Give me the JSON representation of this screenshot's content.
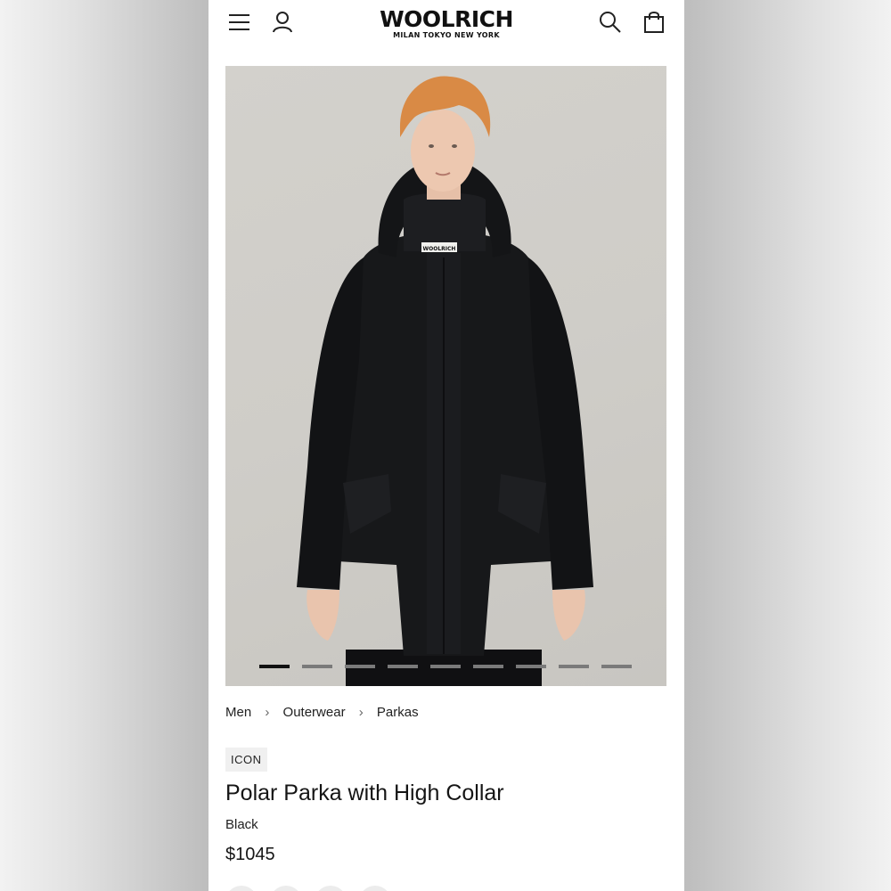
{
  "header": {
    "brand": "WOOLRICH",
    "tagline": "MILAN TOKYO NEW YORK",
    "icons": [
      "menu-icon",
      "account-icon",
      "search-icon",
      "bag-icon"
    ]
  },
  "hero": {
    "slide_count": 9,
    "active_slide": 1,
    "label_text": "WOOLRICH"
  },
  "breadcrumb": [
    "Men",
    "Outerwear",
    "Parkas"
  ],
  "product": {
    "badge": "ICON",
    "name": "Polar Parka with High Collar",
    "color": "Black",
    "price": "$1045"
  },
  "colors": {
    "background": "#ffffff",
    "text": "#151515",
    "coat": "#17181a",
    "hair": "#d98a45"
  }
}
